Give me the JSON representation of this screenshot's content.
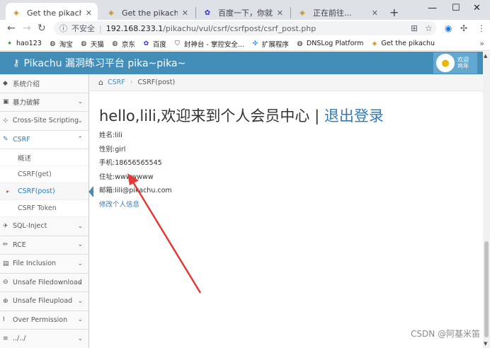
{
  "browser": {
    "tabs": [
      {
        "title": "Get the pikachu",
        "active": true
      },
      {
        "title": "Get the pikachu",
        "active": false
      },
      {
        "title": "百度一下，你就知道",
        "active": false
      },
      {
        "title": "正在前往...",
        "active": false
      }
    ],
    "omnibox": {
      "security": "不安全",
      "url_host": "192.168.233.1",
      "url_path": "/pikachu/vul/csrf/csrfpost/csrf_post.php"
    },
    "bookmarks": [
      {
        "label": "hao123",
        "icon": "hao123-icon"
      },
      {
        "label": "淘宝",
        "icon": "globe-icon"
      },
      {
        "label": "天猫",
        "icon": "globe-icon"
      },
      {
        "label": "京东",
        "icon": "globe-icon"
      },
      {
        "label": "百度",
        "icon": "baidu-icon"
      },
      {
        "label": "封神台 - 掌控安全...",
        "icon": "shield-icon"
      },
      {
        "label": "扩展程序",
        "icon": "puzzle-icon"
      },
      {
        "label": "DNSLog Platform",
        "icon": "globe-icon"
      },
      {
        "label": "Get the pikachu",
        "icon": "pikachu-icon"
      }
    ]
  },
  "app": {
    "title": "Pikachu 漏洞练习平台 pika~pika~",
    "welcome_line1": "欢迎",
    "welcome_line2": "鸡年"
  },
  "sidebar": {
    "items": [
      {
        "label": "系统介绍",
        "icon": "tag-icon"
      },
      {
        "label": "暴力破解",
        "icon": "lock-icon"
      },
      {
        "label": "Cross-Site Scripting",
        "icon": "sitemap-icon"
      },
      {
        "label": "CSRF",
        "icon": "edit-icon"
      }
    ],
    "csrf_sub": [
      "概述",
      "CSRF(get)",
      "CSRF(post)",
      "CSRF Token"
    ],
    "items_after": [
      {
        "label": "SQL-Inject",
        "icon": "fighter-jet-icon"
      },
      {
        "label": "RCE",
        "icon": "pencil-icon"
      },
      {
        "label": "File Inclusion",
        "icon": "file-icon"
      },
      {
        "label": "Unsafe Filedownload",
        "icon": "download-icon"
      },
      {
        "label": "Unsafe Fileupload",
        "icon": "upload-icon"
      },
      {
        "label": "Over Permission",
        "icon": "text-height-icon"
      },
      {
        "label": "../../",
        "icon": "list-icon"
      }
    ]
  },
  "breadcrumb": {
    "parent": "CSRF",
    "current": "CSRF(post)"
  },
  "main": {
    "greeting": "hello,lili,欢迎来到个人会员中心 | ",
    "logout": "退出登录",
    "fields": [
      "姓名:lili",
      "性别:girl",
      "手机:18656565545",
      "住址:wwwwwww",
      "邮箱:lili@pikachu.com"
    ],
    "edit_link": "修改个人信息"
  },
  "watermark": "CSDN @阿基米笛",
  "colors": {
    "header_blue": "#438eb9",
    "link_blue": "#337ab7",
    "annotation_red": "#e53935"
  }
}
